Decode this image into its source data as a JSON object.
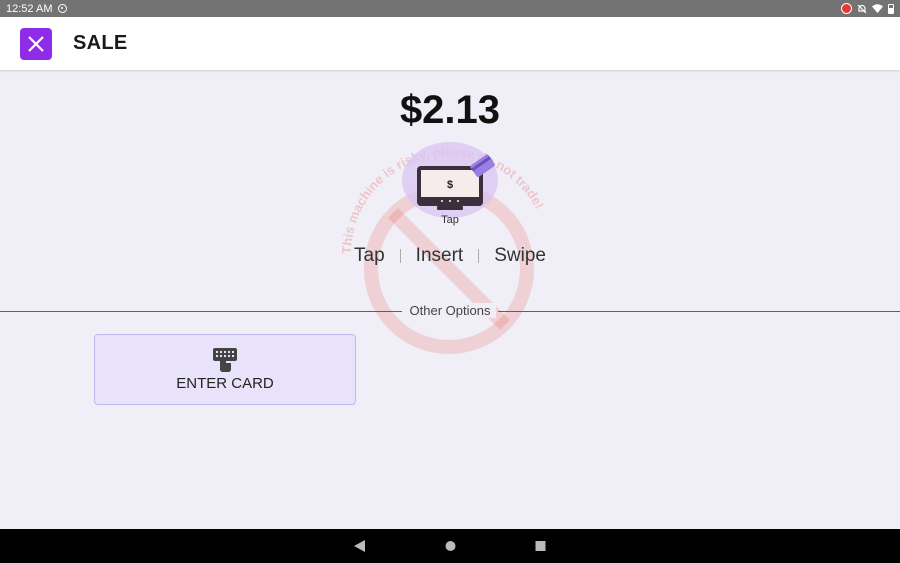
{
  "status_bar": {
    "time": "12:52 AM"
  },
  "app_bar": {
    "title": "SALE"
  },
  "sale": {
    "amount": "$2.13"
  },
  "tap_graphic": {
    "dollar": "$",
    "label": "Tap"
  },
  "methods": [
    "Tap",
    "Insert",
    "Swipe"
  ],
  "other_options_label": "Other Options",
  "enter_card": {
    "label": "ENTER CARD"
  },
  "watermark": {
    "text": "This machine is risky, please do not trade!"
  },
  "colors": {
    "accent": "#8f2ce8",
    "background": "#f0eef6",
    "watermark": "#e53935"
  },
  "icons": [
    "close-icon",
    "keypad-icon",
    "back-icon",
    "home-icon",
    "recents-icon"
  ]
}
